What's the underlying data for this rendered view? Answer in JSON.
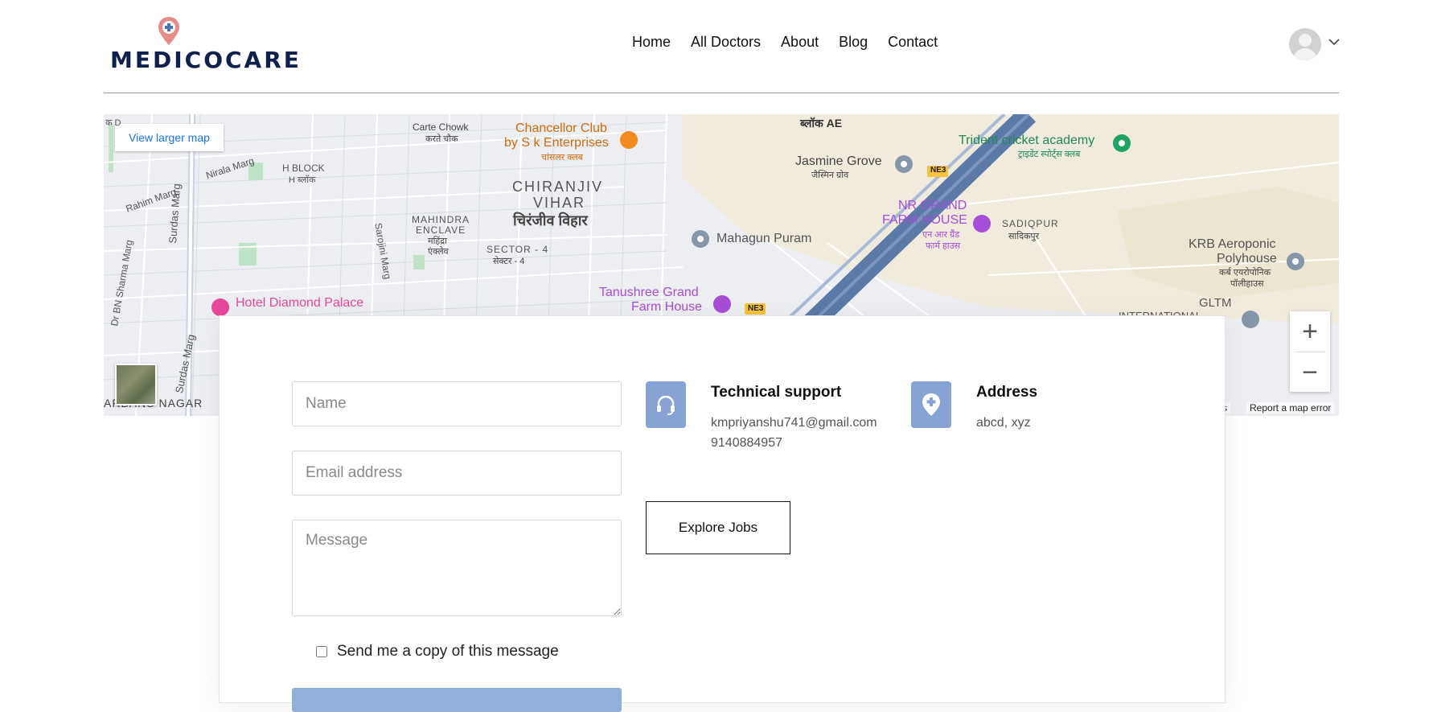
{
  "brand": {
    "name": "MEDICOCARE",
    "pin_color": "#e07070",
    "text_color": "#0f1f4e"
  },
  "nav": {
    "items": [
      {
        "label": "Home"
      },
      {
        "label": "All Doctors"
      },
      {
        "label": "About"
      },
      {
        "label": "Blog"
      },
      {
        "label": "Contact"
      }
    ]
  },
  "user": {
    "avatar_icon": "user-avatar-icon",
    "dropdown_icon": "chevron-down-icon"
  },
  "map": {
    "view_larger": "View larger map",
    "zoom_in": "+",
    "zoom_out": "−",
    "report_error": "Report a map error",
    "terms": "ms",
    "labels": {
      "carte_chowk": "Carte Chowk",
      "carte_chowk_hi": "करते चौक",
      "chancellor": "Chancellor Club",
      "chancellor_2": "by S k Enterprises",
      "chancellor_hi": "चांसलर क्लब",
      "block_ae": "ब्लॉक AE",
      "jasmine": "Jasmine Grove",
      "jasmine_hi": "जैस्मिन ग्रोव",
      "trident": "Trident cricket academy",
      "trident_hi": "ट्राइडेंट स्पोर्ट्स क्लब",
      "chiranjiv_1": "CHIRANJIV",
      "chiranjiv_2": "VIHAR",
      "chiranjiv_hi": "चिरंजीव विहार",
      "nr_grand_1": "NR GRAND",
      "nr_grand_2": "FARM HOUSE",
      "nr_grand_hi_1": "एन आर ग्रैंड",
      "nr_grand_hi_2": "फार्म हाउस",
      "sadiqpur": "SADIQPUR",
      "sadiqpur_hi": "सादिकपुर",
      "h_block": "H BLOCK",
      "h_block_hi": "H ब्लॉक",
      "nirala": "Nirala Marg",
      "rahim": "Rahim Marg",
      "mahindra_1": "MAHINDRA",
      "mahindra_2": "ENCLAVE",
      "mahindra_hi_1": "महिंद्रा",
      "mahindra_hi_2": "एंक्लेव",
      "sector4": "SECTOR - 4",
      "sector4_hi": "सेक्टर - 4",
      "mahagun": "Mahagun Puram",
      "krb_1": "KRB Aeroponic",
      "krb_2": "Polyhouse",
      "krb_hi_1": "कर्ब एयरोपोनिक",
      "krb_hi_2": "पॉलीहाउस",
      "surdas": "Surdas Marg",
      "sarojini": "Sarojini Marg",
      "dr_bn": "Dr BN Sharma Marg",
      "hotel": "Hotel Diamond Palace",
      "tanushree_1": "Tanushree Grand",
      "tanushree_2": "Farm House",
      "gltm": "GLTM",
      "international": "INTERNATIONAL",
      "ne3": "NE3",
      "nagar": "ARBANS NAGAR",
      "k_d": "क D"
    }
  },
  "form": {
    "name_placeholder": "Name",
    "email_placeholder": "Email address",
    "message_placeholder": "Message",
    "copy_label": "Send me a copy of this message"
  },
  "support": {
    "title": "Technical support",
    "email": "kmpriyanshu741@gmail.com",
    "phone": "9140884957",
    "icon": "headset-icon"
  },
  "address": {
    "title": "Address",
    "value": "abcd, xyz",
    "icon": "location-pin-icon"
  },
  "explore_label": "Explore Jobs",
  "colors": {
    "accent": "#87a3d6",
    "map_bg": "#eceef2",
    "link": "#1a73e8",
    "highway": "#5b7aa8"
  }
}
